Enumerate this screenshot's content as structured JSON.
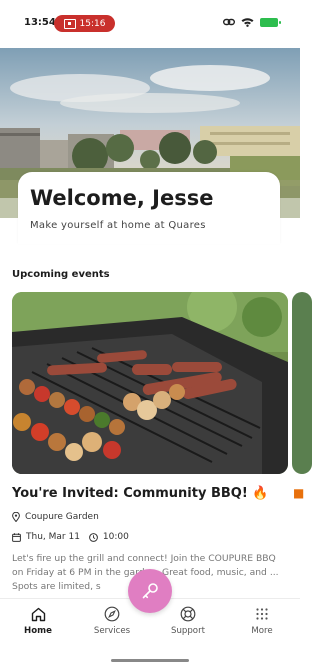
{
  "status_bar": {
    "time": "13:54",
    "recording_time": "15:16"
  },
  "welcome": {
    "title": "Welcome, Jesse",
    "subtitle": "Make yourself at home at Quares"
  },
  "upcoming": {
    "heading": "Upcoming events",
    "events": [
      {
        "title": "You're Invited: Community BBQ!",
        "emoji": "🔥",
        "location": "Coupure Garden",
        "date": "Thu, Mar 11",
        "time": "10:00",
        "description": "Let's fire up the grill and connect! Join the COUPURE BBQ on Friday at 6 PM in the garden. Great food, music, and ... Spots are limited, s"
      }
    ]
  },
  "bottom_nav": {
    "items": [
      {
        "label": "Home",
        "icon": "home-icon",
        "active": true
      },
      {
        "label": "Services",
        "icon": "compass-icon",
        "active": false
      },
      {
        "label": "Support",
        "icon": "lifebuoy-icon",
        "active": false
      },
      {
        "label": "More",
        "icon": "grid-dots-icon",
        "active": false
      }
    ]
  },
  "colors": {
    "accent": "#e07ec2",
    "recording": "#c9302c",
    "battery": "#2dbd4e"
  }
}
